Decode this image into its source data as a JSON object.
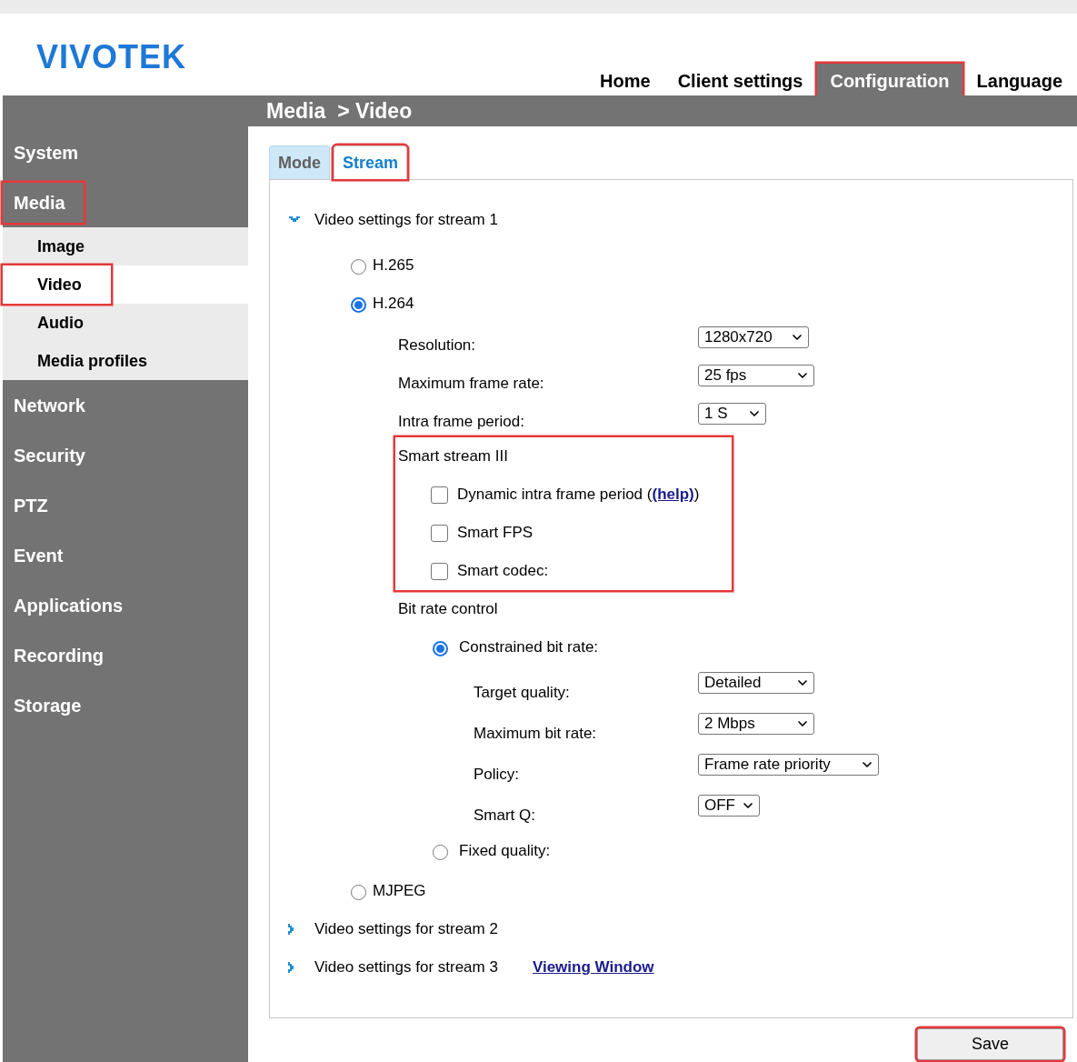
{
  "header": {
    "logo": "VIVOTEK",
    "nav": [
      {
        "label": "Home",
        "selected": false,
        "highlighted": false
      },
      {
        "label": "Client settings",
        "selected": false,
        "highlighted": false
      },
      {
        "label": "Configuration",
        "selected": true,
        "highlighted": true
      },
      {
        "label": "Language",
        "selected": false,
        "highlighted": false
      }
    ]
  },
  "breadcrumb": {
    "section": "Media",
    "page": "> Video"
  },
  "sidebar": {
    "items": [
      {
        "label": "System",
        "selected": false,
        "highlighted": false
      },
      {
        "label": "Media",
        "selected": false,
        "highlighted": true,
        "children": [
          {
            "label": "Image",
            "selected": false,
            "highlighted": false
          },
          {
            "label": "Video",
            "selected": true,
            "highlighted": true
          },
          {
            "label": "Audio",
            "selected": false,
            "highlighted": false
          },
          {
            "label": "Media profiles",
            "selected": false,
            "highlighted": false
          }
        ]
      },
      {
        "label": "Network",
        "selected": false,
        "highlighted": false
      },
      {
        "label": "Security",
        "selected": false,
        "highlighted": false
      },
      {
        "label": "PTZ",
        "selected": false,
        "highlighted": false
      },
      {
        "label": "Event",
        "selected": false,
        "highlighted": false
      },
      {
        "label": "Applications",
        "selected": false,
        "highlighted": false
      },
      {
        "label": "Recording",
        "selected": false,
        "highlighted": false
      },
      {
        "label": "Storage",
        "selected": false,
        "highlighted": false
      }
    ]
  },
  "tabs": [
    {
      "label": "Mode",
      "selected": false,
      "highlighted": false
    },
    {
      "label": "Stream",
      "selected": true,
      "highlighted": true
    }
  ],
  "stream1": {
    "title": "Video settings for stream 1",
    "expanded": true,
    "codecs": [
      {
        "label": "H.265",
        "selected": false
      },
      {
        "label": "H.264",
        "selected": true,
        "fields": [
          {
            "label": "Resolution:",
            "value": "1280x720"
          },
          {
            "label": "Maximum frame rate:",
            "value": "25 fps"
          },
          {
            "label": "Intra frame period:",
            "value": "1 S"
          }
        ],
        "smart_stream": {
          "title": "Smart stream III",
          "highlighted": true,
          "options": [
            {
              "label": "Dynamic intra frame period (",
              "link": "(help)",
              "suffix": ")",
              "checked": false
            },
            {
              "label": "Smart FPS",
              "checked": false
            },
            {
              "label": "Smart codec:",
              "checked": false
            }
          ]
        },
        "bit_rate_control": {
          "title": "Bit rate control",
          "modes": [
            {
              "label": "Constrained bit rate:",
              "selected": true,
              "fields": [
                {
                  "label": "Target quality:",
                  "value": "Detailed"
                },
                {
                  "label": "Maximum bit rate:",
                  "value": "2 Mbps"
                },
                {
                  "label": "Policy:",
                  "value": "Frame rate priority"
                },
                {
                  "label": "Smart Q:",
                  "value": "OFF"
                }
              ]
            },
            {
              "label": "Fixed quality:",
              "selected": false
            }
          ]
        }
      },
      {
        "label": "MJPEG",
        "selected": false
      }
    ]
  },
  "other_streams": [
    {
      "title": "Video settings for stream 2",
      "expanded": false
    },
    {
      "title": "Video settings for stream 3",
      "expanded": false,
      "link": "Viewing Window"
    }
  ],
  "save_button": {
    "label": "Save",
    "highlighted": true
  }
}
